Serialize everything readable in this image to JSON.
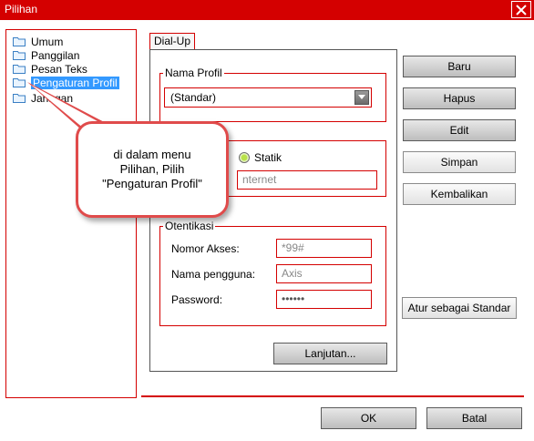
{
  "window": {
    "title": "Pilihan",
    "accent": "#d40000"
  },
  "tree": {
    "items": [
      {
        "label": "Umum",
        "icon": "folder-icon"
      },
      {
        "label": "Panggilan",
        "icon": "folder-icon"
      },
      {
        "label": "Pesan Teks",
        "icon": "folder-icon"
      },
      {
        "label": "Pengaturan Profil",
        "icon": "folder-icon",
        "selected": true
      },
      {
        "label": "Jaringan",
        "icon": "folder-icon"
      }
    ]
  },
  "tabs": [
    {
      "label": "Dial-Up",
      "active": true
    }
  ],
  "profile": {
    "legend": "Nama Profil",
    "selected": "(Standar)"
  },
  "apn": {
    "static_label": "Statik",
    "static_selected": true,
    "value": "nternet"
  },
  "auth": {
    "legend": "Otentikasi",
    "access_number_label": "Nomor Akses:",
    "access_number_value": "*99#",
    "username_label": "Nama pengguna:",
    "username_value": "Axis",
    "password_label": "Password:",
    "password_value": "••••••"
  },
  "buttons": {
    "advanced": "Lanjutan...",
    "new": "Baru",
    "delete": "Hapus",
    "edit": "Edit",
    "save": "Simpan",
    "revert": "Kembalikan",
    "set_default": "Atur sebagai Standar",
    "ok": "OK",
    "cancel": "Batal"
  },
  "callout": {
    "text": "di dalam menu\nPilihan, Pilih\n\"Pengaturan Profil\""
  }
}
